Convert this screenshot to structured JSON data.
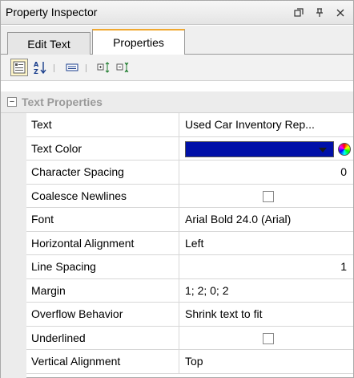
{
  "window": {
    "title": "Property Inspector"
  },
  "tabs": [
    {
      "label": "Edit Text"
    },
    {
      "label": "Properties"
    }
  ],
  "toolbar": {
    "sort_label": "A↓Z",
    "tools": [
      "categorized-icon",
      "sort-alphabetical-icon",
      "property-pages-icon",
      "expand-all-icon",
      "collapse-all-icon"
    ]
  },
  "section": {
    "label": "Text Properties",
    "collapse_glyph": "−"
  },
  "properties": [
    {
      "name": "Text",
      "value": "Used Car Inventory Rep..."
    },
    {
      "name": "Text Color",
      "value": "",
      "color": "#0010a8"
    },
    {
      "name": "Character Spacing",
      "value": "0"
    },
    {
      "name": "Coalesce Newlines",
      "value": ""
    },
    {
      "name": "Font",
      "value": "Arial Bold 24.0 (Arial)"
    },
    {
      "name": "Horizontal Alignment",
      "value": "Left"
    },
    {
      "name": "Line Spacing",
      "value": "1"
    },
    {
      "name": "Margin",
      "value": "1; 2; 0; 2"
    },
    {
      "name": "Overflow Behavior",
      "value": "Shrink text to fit"
    },
    {
      "name": "Underlined",
      "value": ""
    },
    {
      "name": "Vertical Alignment",
      "value": "Top"
    }
  ]
}
